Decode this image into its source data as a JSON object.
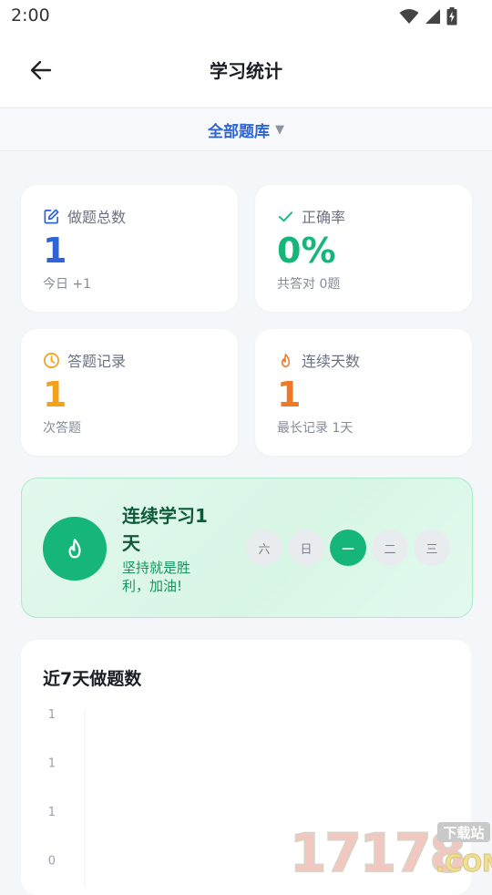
{
  "status": {
    "time": "2:00"
  },
  "header": {
    "title": "学习统计"
  },
  "filter": {
    "label": "全部题库"
  },
  "stats": [
    {
      "label": "做题总数",
      "value": "1",
      "sub": "今日 +1",
      "color": "#2f64d6",
      "icon": "edit-icon"
    },
    {
      "label": "正确率",
      "value": "0%",
      "sub": "共答对 0题",
      "color": "#16b67a",
      "icon": "check-icon"
    },
    {
      "label": "答题记录",
      "value": "1",
      "sub": "次答题",
      "color": "#f2a11b",
      "icon": "clock-icon"
    },
    {
      "label": "连续天数",
      "value": "1",
      "sub": "最长记录 1天",
      "color": "#ee7a27",
      "icon": "flame-icon"
    }
  ],
  "streak": {
    "title": "连续学习1天",
    "motto": "坚持就是胜利，加油!",
    "days": [
      {
        "label": "六",
        "active": false
      },
      {
        "label": "日",
        "active": false
      },
      {
        "label": "一",
        "active": true
      },
      {
        "label": "二",
        "active": false
      },
      {
        "label": "三",
        "active": false
      }
    ]
  },
  "chart_data": {
    "type": "bar",
    "title": "近7天做题数",
    "ytick_labels": [
      "1",
      "1",
      "1",
      "0"
    ]
  },
  "watermark": {
    "brand": "17178",
    "tag": "下载站",
    "suffix": ".COM"
  }
}
